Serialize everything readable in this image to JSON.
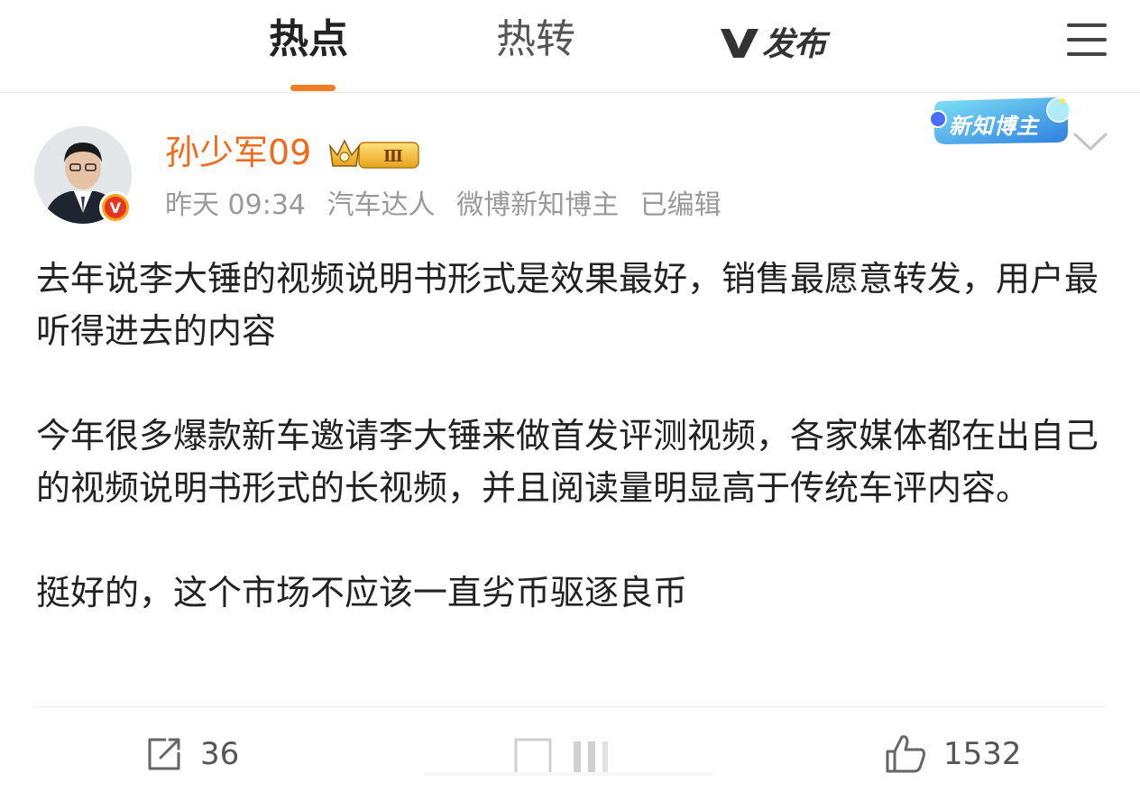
{
  "nav": {
    "tabs": [
      {
        "label": "热点",
        "active": true
      },
      {
        "label": "热转",
        "active": false
      }
    ],
    "publish_label": "发布",
    "accent_color": "#f07d23"
  },
  "post": {
    "author": {
      "name": "孙少军09",
      "name_color": "#f26a1b",
      "badge_level": "Ⅲ",
      "verified_badge": "V"
    },
    "meta": {
      "time": "昨天 09:34",
      "tag1": "汽车达人",
      "tag2": "微博新知博主",
      "edited": "已编辑"
    },
    "corner_badge": "新知博主",
    "paragraphs": [
      "去年说李大锤的视频说明书形式是效果最好，销售最愿意转发，用户最听得进去的内容",
      "今年很多爆款新车邀请李大锤来做首发评测视频，各家媒体都在出自己的视频说明书形式的长视频，并且阅读量明显高于传统车评内容。",
      "挺好的，这个市场不应该一直劣币驱逐良币"
    ]
  },
  "actions": {
    "repost_count": "36",
    "like_count": "1532"
  },
  "icons": [
    "menu-icon",
    "chevron-down-icon",
    "repost-icon",
    "like-icon",
    "crown-icon",
    "verified-icon"
  ]
}
